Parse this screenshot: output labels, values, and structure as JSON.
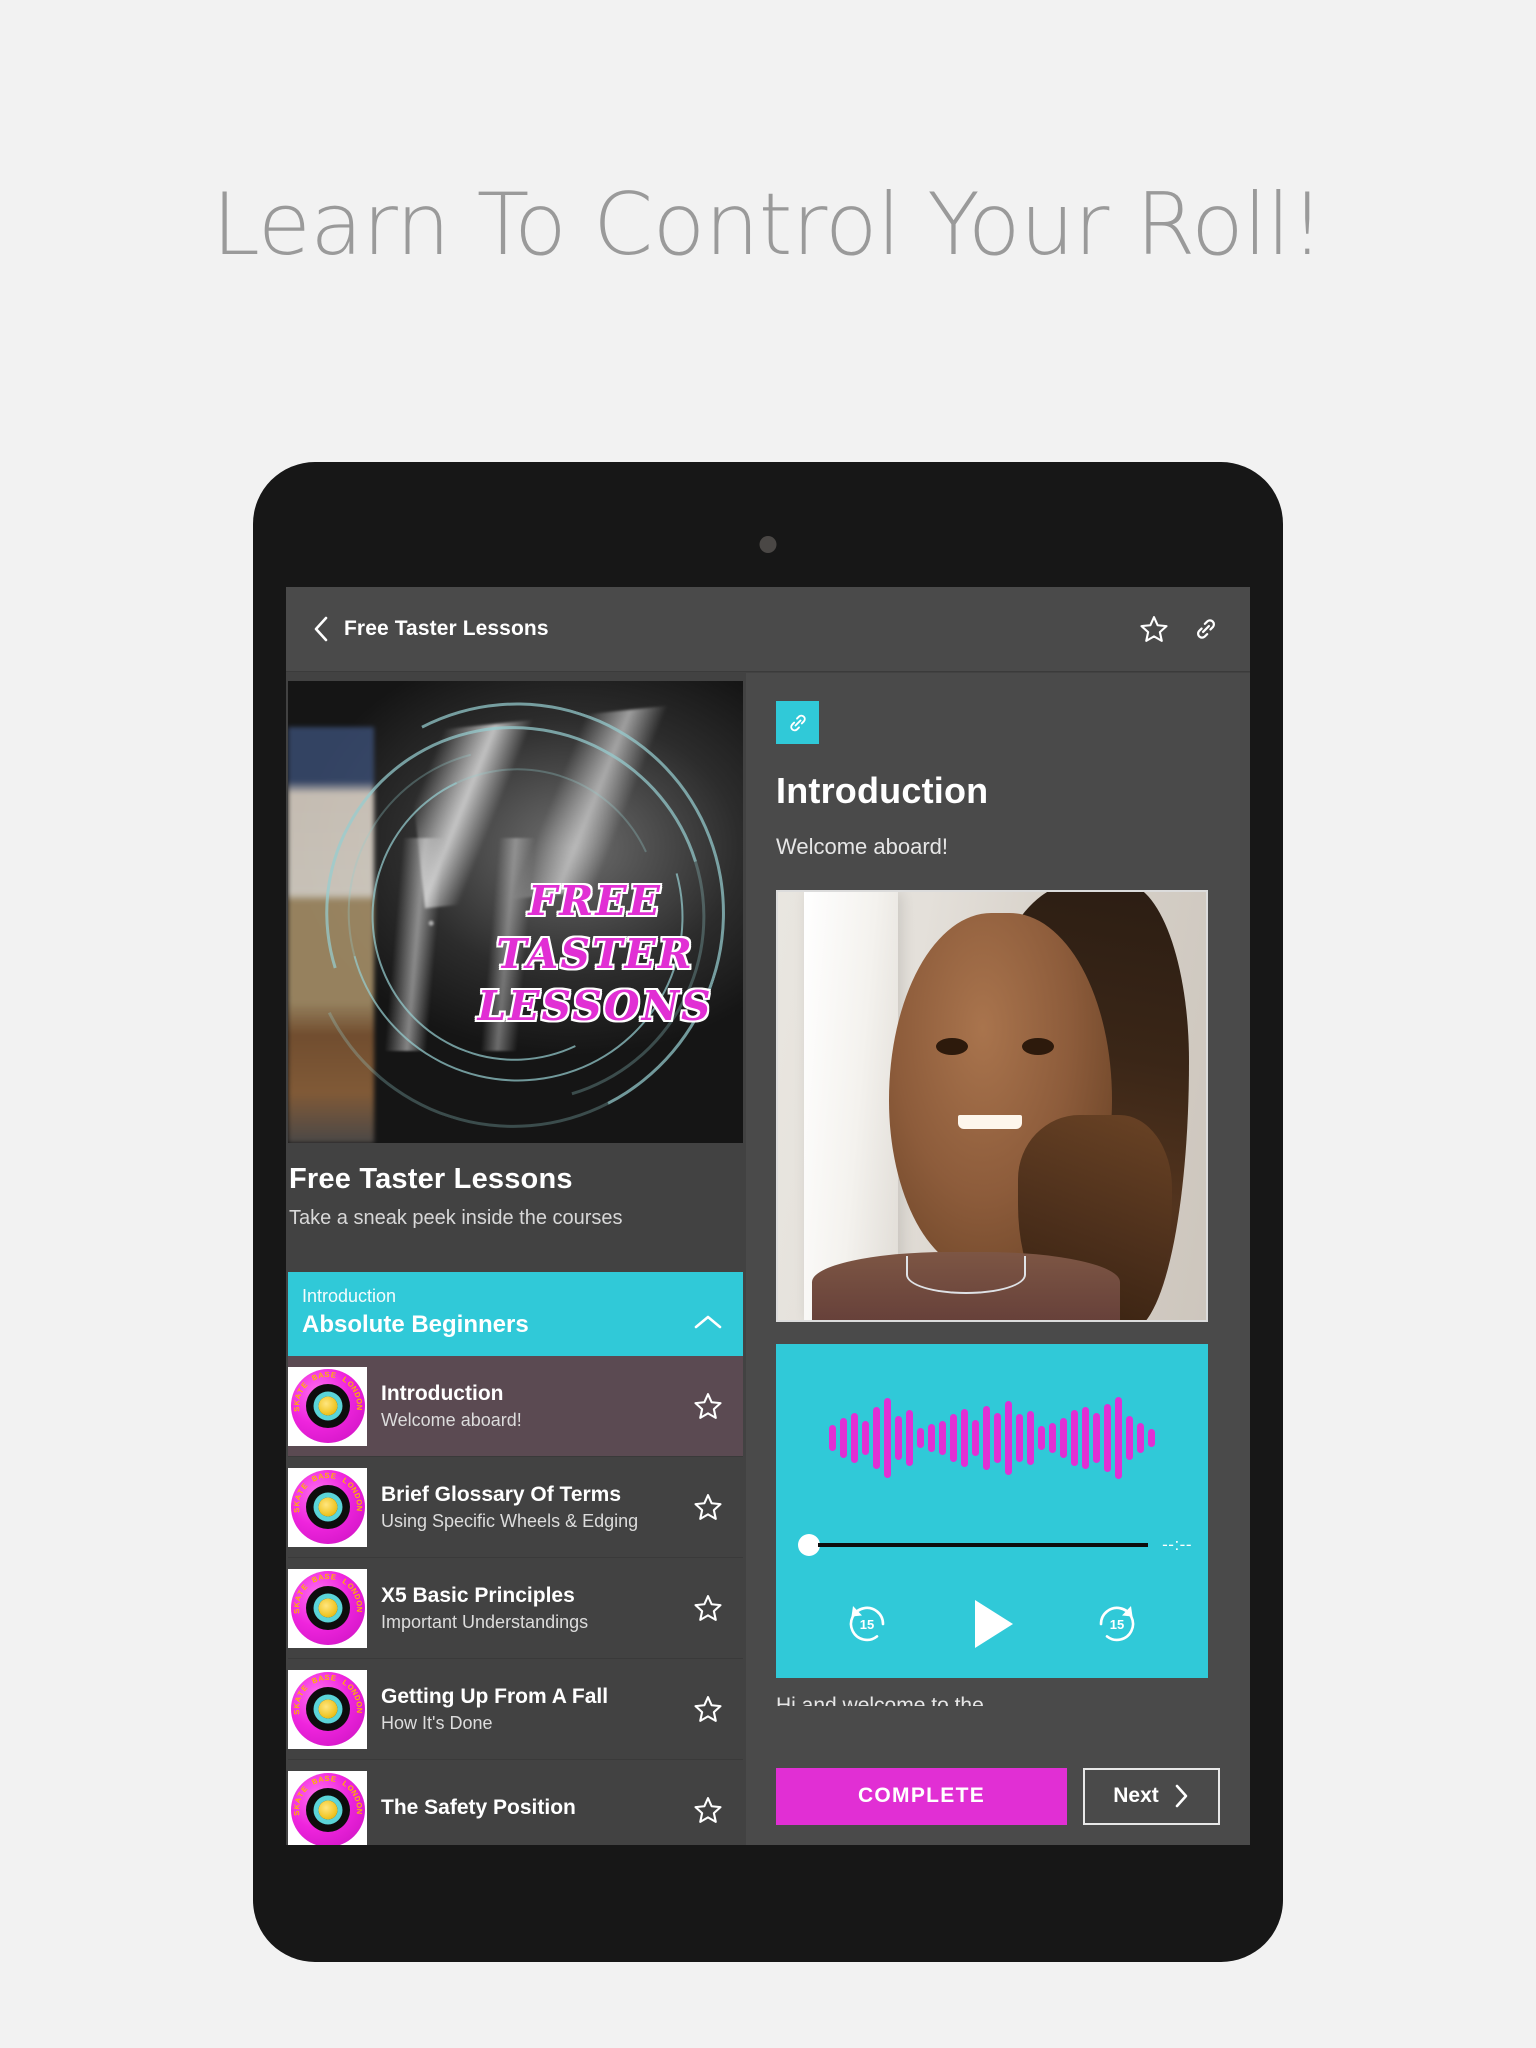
{
  "promo": {
    "headline": "Learn To Control Your Roll!"
  },
  "appbar": {
    "back_icon": "chevron-left-icon",
    "title": "Free Taster Lessons",
    "favorite_icon": "star-outline-icon",
    "link_icon": "link-icon"
  },
  "course": {
    "cover_text_lines": [
      "FREE",
      "TASTER",
      "LESSONS"
    ],
    "title": "Free Taster Lessons",
    "subtitle": "Take a sneak peek inside the courses",
    "section": {
      "eyebrow": "Introduction",
      "name": "Absolute Beginners",
      "collapse_icon": "chevron-up-icon"
    },
    "lessons": [
      {
        "title": "Introduction",
        "subtitle": "Welcome aboard!",
        "active": true,
        "star_icon": "star-outline-icon",
        "thumb_text": "SKATE BASE LONDON"
      },
      {
        "title": "Brief Glossary Of Terms",
        "subtitle": "Using Specific Wheels & Edging",
        "active": false,
        "star_icon": "star-outline-icon",
        "thumb_text": "SKATE BASE LONDON"
      },
      {
        "title": "X5 Basic Principles",
        "subtitle": "Important Understandings",
        "active": false,
        "star_icon": "star-outline-icon",
        "thumb_text": "SKATE BASE LONDON"
      },
      {
        "title": "Getting Up From A Fall",
        "subtitle": "How It's Done",
        "active": false,
        "star_icon": "star-outline-icon",
        "thumb_text": "SKATE BASE LONDON"
      },
      {
        "title": "The Safety Position",
        "subtitle": "",
        "active": false,
        "star_icon": "star-outline-icon",
        "thumb_text": "SKATE BASE LONDON"
      }
    ]
  },
  "detail": {
    "link_chip_icon": "link-icon",
    "heading": "Introduction",
    "description": "Welcome aboard!",
    "video": {
      "name": "instructor-video-thumbnail"
    },
    "audio": {
      "waveform_icon": "audio-waveform",
      "waveform_bars": [
        26,
        40,
        50,
        34,
        62,
        80,
        44,
        56,
        20,
        28,
        34,
        48,
        58,
        36,
        64,
        50,
        74,
        48,
        54,
        24,
        30,
        40,
        56,
        62,
        50,
        68,
        82,
        44,
        30,
        18
      ],
      "progress_percent": 0,
      "time_label": "--:--",
      "rewind_label": "15",
      "rewind_icon": "replay-15-icon",
      "play_icon": "play-icon",
      "forward_label": "15",
      "forward_icon": "forward-15-icon"
    },
    "clipped_note": "Hi and welcome to the...",
    "complete_label": "COMPLETE",
    "next_label": "Next",
    "next_icon": "chevron-right-icon"
  },
  "colors": {
    "accent_cyan": "#30c9d8",
    "accent_magenta": "#e12fd4",
    "surface": "#424242",
    "surface_alt": "#4a4a4a",
    "active_row": "#5b4a52",
    "page_bg": "#f2f2f2",
    "headline_grey": "#9a9a9a"
  }
}
